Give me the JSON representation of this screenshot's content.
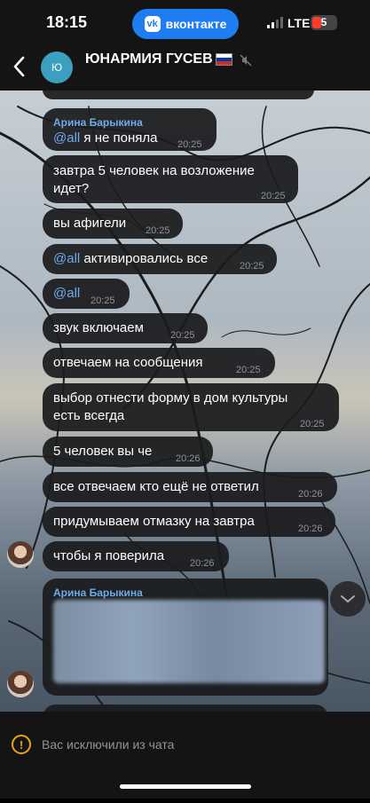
{
  "status_bar": {
    "time": "18:15",
    "app_pill": "вконтакте",
    "app_logo": "vk",
    "network": "LTE",
    "battery": "5"
  },
  "header": {
    "title": "ЮНАРМИЯ ГУСЕВ",
    "avatar_initial": "Ю",
    "flag_colors": [
      "#ffffff",
      "#0039a6",
      "#d52b1e"
    ]
  },
  "messages": [
    {
      "sender": "Арина Барыкина",
      "mention": "@all",
      "text": " я не поняла",
      "time": "20:25"
    },
    {
      "text_line1": "завтра 5 человек на возложение",
      "text_line2": "идет?",
      "time": "20:25"
    },
    {
      "text": "вы афигели",
      "time": "20:25"
    },
    {
      "mention": "@all",
      "text": " активировались все",
      "time": "20:25"
    },
    {
      "mention": "@all",
      "time": "20:25"
    },
    {
      "text": "звук включаем",
      "time": "20:25"
    },
    {
      "text": "отвечаем на сообщения",
      "time": "20:25"
    },
    {
      "text_line1": "выбор отнести форму в дом культуры",
      "text_line2": "есть всегда",
      "time": "20:25"
    },
    {
      "text": "5 человек вы че",
      "time": "20:26"
    },
    {
      "text": "все отвечаем кто ещё не ответил",
      "time": "20:26"
    },
    {
      "text": "придумываем отмазку на завтра",
      "time": "20:26"
    },
    {
      "text": "чтобы я поверила",
      "time": "20:26"
    },
    {
      "sender": "Арина Барыкина"
    }
  ],
  "footer": {
    "notice": "Вас исключили из чата"
  },
  "colors": {
    "accent": "#1e7df2",
    "mention": "#71aaeb",
    "warning": "#e8a317"
  }
}
